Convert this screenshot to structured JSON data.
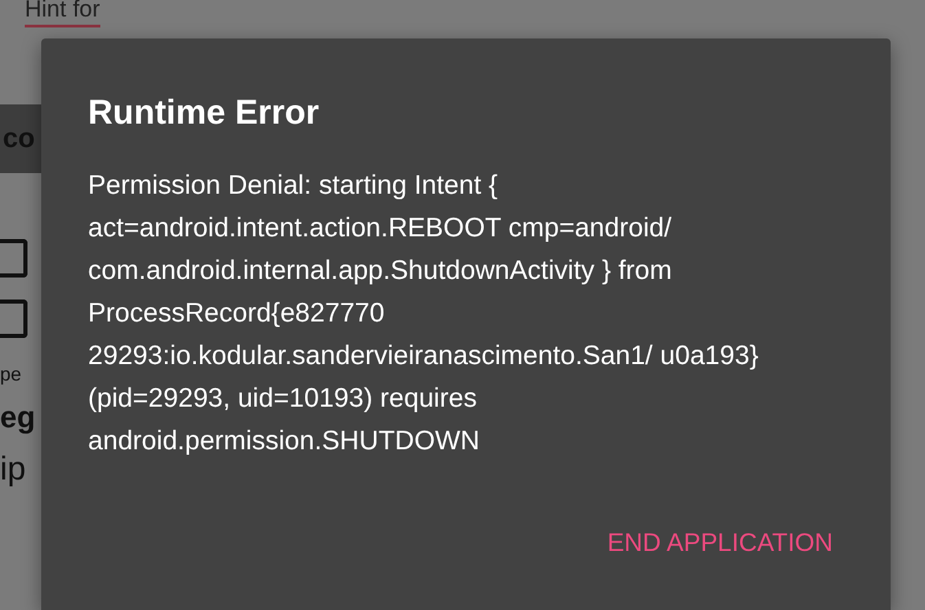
{
  "background": {
    "field_hint": "Hint for",
    "header_text": "co",
    "checkboxes": [
      {
        "checked": false
      },
      {
        "checked": false
      }
    ],
    "label_text": "pe",
    "heading_text": "eg",
    "body_text": "ip"
  },
  "dialog": {
    "title": "Runtime Error",
    "message": "Permission Denial: starting Intent { act=android.intent.action.REBOOT cmp=android/ com.android.internal.app.ShutdownActivity } from ProcessRecord{e827770 29293:io.kodular.sandervieiranascimento.San1/ u0a193} (pid=29293, uid=10193) requires android.permission.SHUTDOWN",
    "buttons": [
      "END APPLICATION"
    ]
  }
}
